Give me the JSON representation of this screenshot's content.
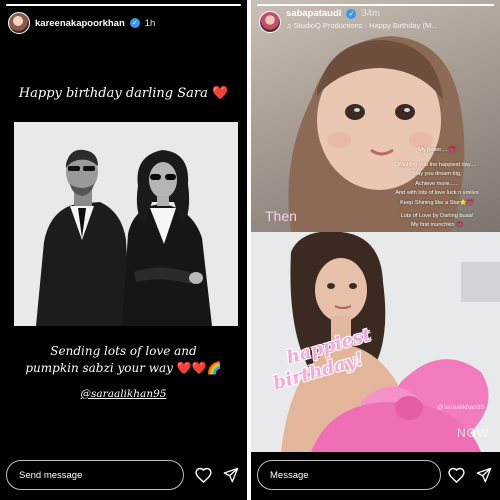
{
  "left_story": {
    "username": "kareenakapoorkhan",
    "time": "1h",
    "verified_icon": "verified-badge-icon",
    "heading": "Happy birthday darling Sara",
    "heart": "❤️",
    "caption_line1": "Sending lots of love and",
    "caption_line2": "pumpkin sabzi your way",
    "caption_emojis": "❤️❤️🌈",
    "mention": "@saraalikhan95",
    "message_placeholder": "Send message"
  },
  "right_story": {
    "username": "sabapataudi",
    "time": "34m",
    "music": "StudioQ Productions · Happy Birthday (M...",
    "then_label": "Then",
    "note_lines": [
      "My poser.....💗",
      "Wishing you the happiest day....",
      "May you dream big,",
      "Achieve more......",
      "And with lots of love luck n smiles",
      "Keep Shining like a Star🌟💗",
      "Lots of Love by Darling buaa!",
      "My first munchkin 💗"
    ],
    "sticker_line1": "happiest",
    "sticker_line2": "birthday!",
    "now_label": "NOW",
    "watermark": "@saraalikhan95",
    "message_placeholder": "Message"
  },
  "colors": {
    "background": "#000000",
    "heart_red": "#e0245e",
    "sticker_pink": "#f7a8d8",
    "verified_blue": "#3897f0"
  }
}
